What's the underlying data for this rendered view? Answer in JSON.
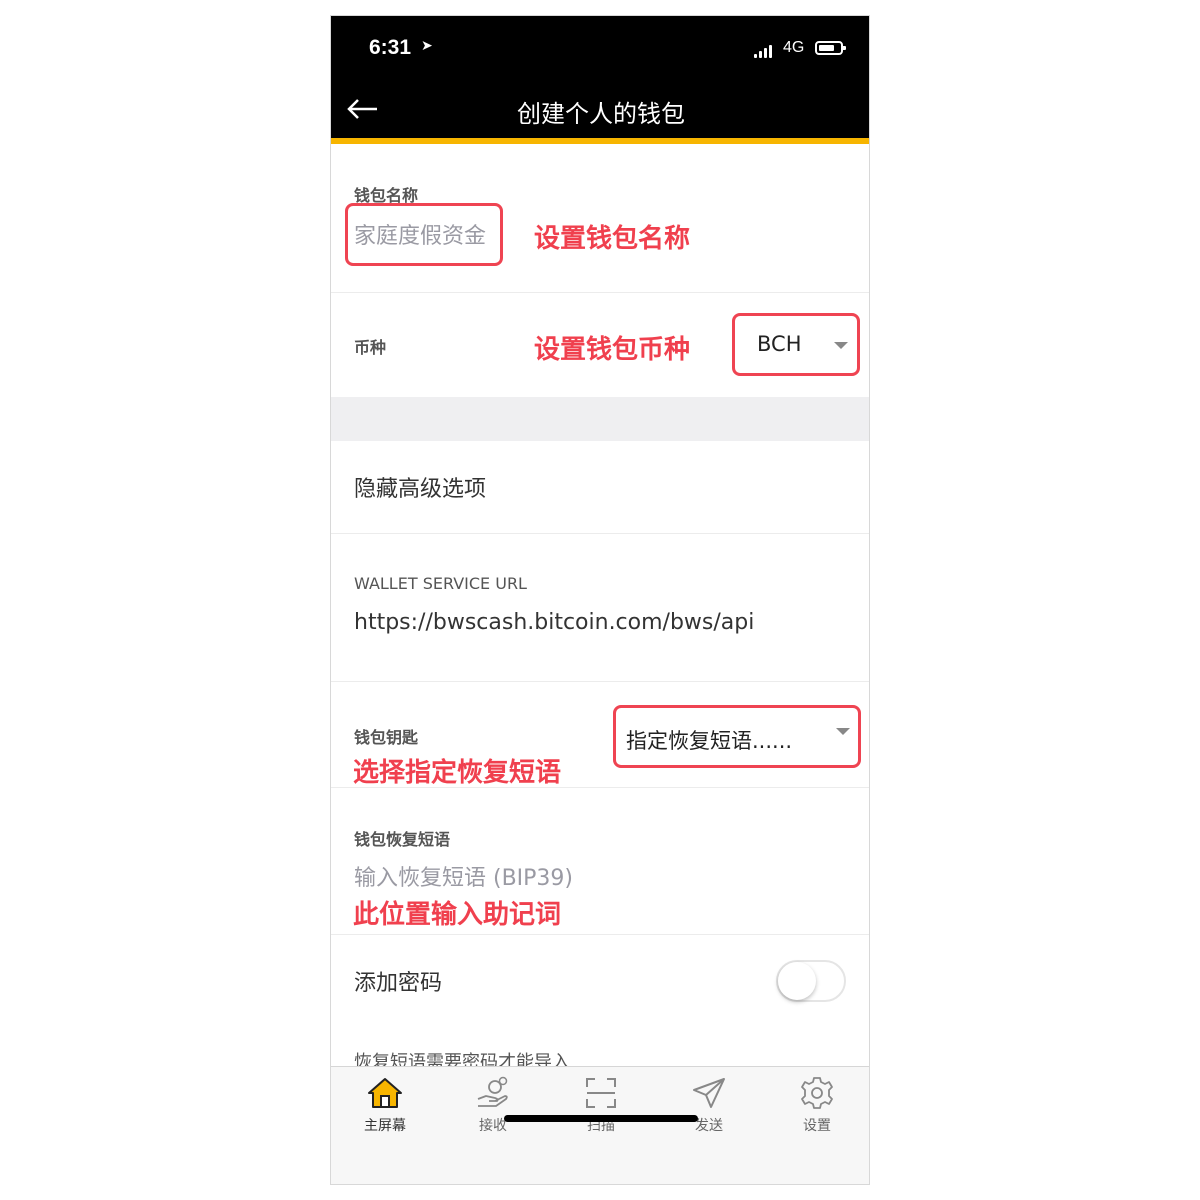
{
  "status": {
    "time": "6:31",
    "network": "4G"
  },
  "nav": {
    "title": "创建个人的钱包"
  },
  "wallet_name": {
    "label": "钱包名称",
    "placeholder": "家庭度假资金",
    "annotation": "设置钱包名称"
  },
  "coin": {
    "label": "币种",
    "annotation": "设置钱包币种",
    "selected": "BCH"
  },
  "advanced": {
    "label": "隐藏高级选项"
  },
  "service": {
    "label": "WALLET SERVICE URL",
    "value": "https://bwscash.bitcoin.com/bws/api"
  },
  "wallet_key": {
    "label": "钱包钥匙",
    "annotation": "选择指定恢复短语",
    "selected": "指定恢复短语......"
  },
  "recovery": {
    "label": "钱包恢复短语",
    "placeholder": "输入恢复短语 (BIP39)",
    "annotation": "此位置输入助记词"
  },
  "password": {
    "label": "添加密码",
    "toggle_on": false,
    "note": "恢复短语需要密码才能导入"
  },
  "tabs": [
    {
      "label": "主屏幕",
      "icon": "home-icon",
      "active": true
    },
    {
      "label": "接收",
      "icon": "receive-icon",
      "active": false
    },
    {
      "label": "扫描",
      "icon": "scan-icon",
      "active": false
    },
    {
      "label": "发送",
      "icon": "send-icon",
      "active": false
    },
    {
      "label": "设置",
      "icon": "gear-icon",
      "active": false
    }
  ],
  "colors": {
    "accent": "#f7b500",
    "annotation": "#f0404e",
    "header_bg": "#000000"
  }
}
